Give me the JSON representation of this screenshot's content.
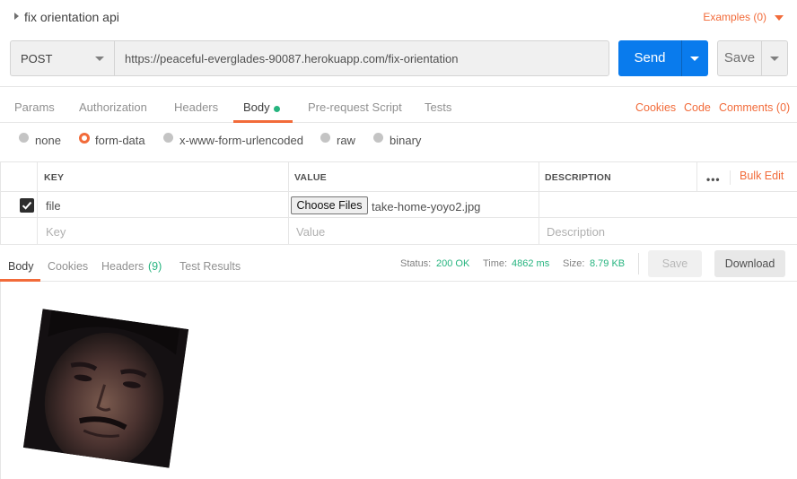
{
  "request": {
    "name": "fix orientation api",
    "examples_label": "Examples (0)",
    "method": "POST",
    "url": "https://peaceful-everglades-90087.herokuapp.com/fix-orientation",
    "send_label": "Send",
    "save_label": "Save"
  },
  "request_tabs": {
    "items": [
      "Params",
      "Authorization",
      "Headers",
      "Body",
      "Pre-request Script",
      "Tests"
    ],
    "active": "Body",
    "links": [
      "Cookies",
      "Code",
      "Comments (0)"
    ]
  },
  "body_modes": {
    "options": [
      "none",
      "form-data",
      "x-www-form-urlencoded",
      "raw",
      "binary"
    ],
    "selected": "form-data"
  },
  "form_table": {
    "headers": {
      "key": "KEY",
      "value": "VALUE",
      "description": "DESCRIPTION"
    },
    "bulk_edit": "Bulk Edit",
    "rows": [
      {
        "enabled": true,
        "key": "file",
        "file_button": "Choose Files",
        "value": "take-home-yoyo2.jpg",
        "description": ""
      }
    ],
    "placeholders": {
      "key": "Key",
      "value": "Value",
      "description": "Description"
    }
  },
  "response": {
    "tabs": [
      "Body",
      "Cookies",
      "Headers",
      "(9)",
      "Test Results"
    ],
    "active_tab": "Body",
    "status_label": "Status:",
    "status_value": "200 OK",
    "time_label": "Time:",
    "time_value": "4862 ms",
    "size_label": "Size:",
    "size_value": "8.79 KB",
    "save_label": "Save",
    "download_label": "Download"
  },
  "colors": {
    "accent": "#f26b3a",
    "send_blue": "#097bed",
    "success_green": "#26b47f"
  }
}
